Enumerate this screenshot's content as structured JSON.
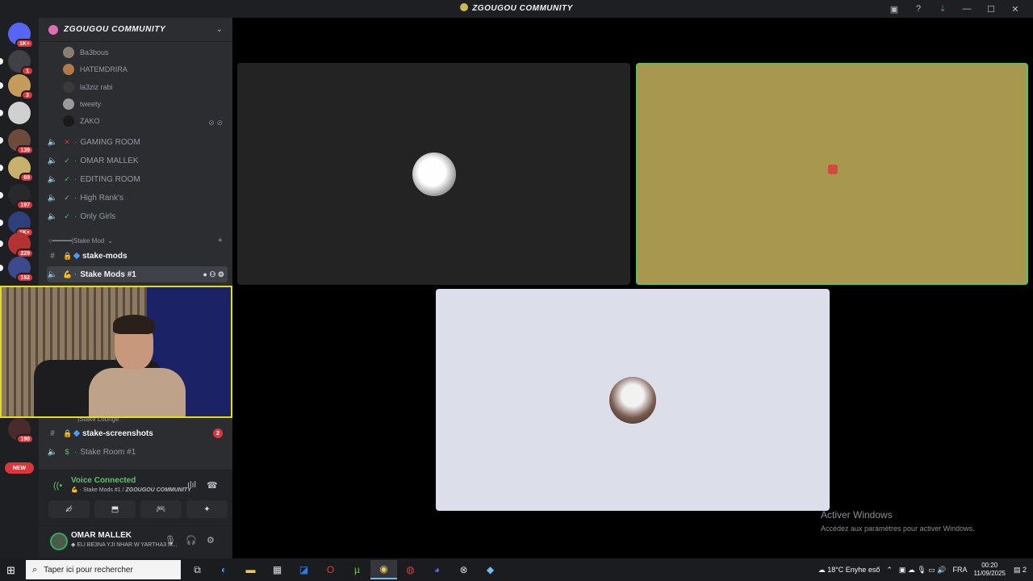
{
  "window": {
    "title": "ZGOUGOU COMMUNITY"
  },
  "servers": {
    "badges": [
      "1K+",
      "1",
      "3",
      "139",
      "69",
      "197",
      "1K+",
      "229",
      "192",
      "190"
    ],
    "new_label": "NEW"
  },
  "guild": {
    "name": "ZGOUGOU COMMUNITY"
  },
  "voice_users": [
    "Ba3bous",
    "HATEMDRIRA",
    "la3ziz rabi",
    "tweety",
    "ZAKO"
  ],
  "voice_channels": [
    {
      "name": "GAMING ROOM",
      "status": "✕"
    },
    {
      "name": "OMAR MALLEK",
      "status": "✓"
    },
    {
      "name": "EDITING ROOM",
      "status": "✓"
    },
    {
      "name": "High Rank's",
      "status": "✓"
    },
    {
      "name": "Only Girls",
      "status": "✓"
    }
  ],
  "categories": {
    "stake_mod": "○━━━━━|Stake Mod",
    "stake_lounge": "|Stake Lounge"
  },
  "channels": {
    "stake_mods": "stake-mods",
    "stake_mods_1": "Stake Mods #1",
    "stake_screenshots": "stake-screenshots",
    "stake_screenshots_unread": "2",
    "stake_room_1": "Stake Room #1"
  },
  "voice_panel": {
    "status": "Voice Connected",
    "channel": "Stake Mods #1",
    "server": "ZGOUGOU COMMUNITY"
  },
  "user": {
    "name": "OMAR MALLEK",
    "status": "ELI BE3NA YJI NHAR W YARTHA3 M..."
  },
  "watermark": {
    "line1": "Activer Windows",
    "line2": "Accédez aux paramètres pour activer Windows."
  },
  "taskbar": {
    "search_placeholder": "Taper ici pour rechercher",
    "weather": "18°C  Enyhe eső",
    "lang": "FRA",
    "time": "00:20",
    "date": "11/09/2025",
    "notif_count": "2"
  },
  "colors": {
    "accent_green": "#57c462",
    "badge_red": "#da373c",
    "webcam_border": "#e3dd1a",
    "speaking_tile": "#a8984f"
  },
  "icons": [
    "discord-icon",
    "speaker-icon",
    "hash-icon",
    "lock-icon",
    "mic-icon",
    "headphones-icon",
    "gear-icon",
    "camera-off-icon",
    "screen-share-icon",
    "activity-icon",
    "soundboard-icon",
    "hangup-icon",
    "signal-icon"
  ]
}
